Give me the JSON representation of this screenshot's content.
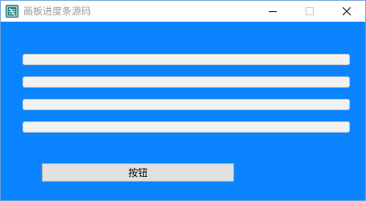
{
  "window": {
    "title": "画板进度条源码",
    "icon": "app-logo-icon",
    "controls": [
      "minimize-icon",
      "maximize-icon",
      "close-icon"
    ]
  },
  "colors": {
    "client_background": "#0a84ff",
    "bar_track": "#f2f2f2",
    "bar_fill": "#06b025",
    "button_face": "#e1e1e1"
  },
  "progress_bars": [
    {
      "value": 0
    },
    {
      "value": 0
    },
    {
      "value": 0
    },
    {
      "value": 0
    }
  ],
  "button": {
    "label": "按钮"
  }
}
